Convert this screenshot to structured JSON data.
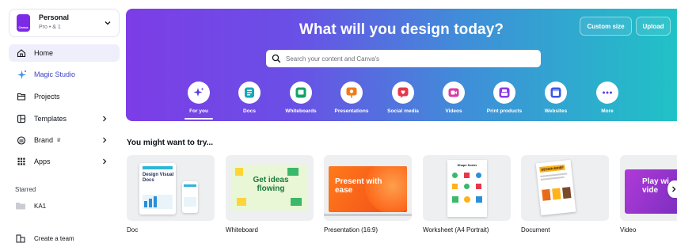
{
  "team": {
    "name": "Personal",
    "sub": "Pro • & 1",
    "logo_text": "Canva"
  },
  "nav": [
    {
      "label": "Home"
    },
    {
      "label": "Magic Studio"
    },
    {
      "label": "Projects"
    },
    {
      "label": "Templates"
    },
    {
      "label": "Brand"
    },
    {
      "label": "Apps"
    }
  ],
  "starred": {
    "title": "Starred",
    "items": [
      {
        "label": "KA1"
      }
    ]
  },
  "create_team_label": "Create a team",
  "hero": {
    "title": "What will you design today?",
    "custom_size_label": "Custom size",
    "upload_label": "Upload",
    "search_placeholder": "Search your content and Canva's",
    "categories": [
      {
        "label": "For you",
        "icon": "sparkle-icon",
        "color": "#5b3ce6"
      },
      {
        "label": "Docs",
        "icon": "doc-icon",
        "color": "#16a7b8"
      },
      {
        "label": "Whiteboards",
        "icon": "whiteboard-icon",
        "color": "#12a36a"
      },
      {
        "label": "Presentations",
        "icon": "presentation-icon",
        "color": "#f07b17"
      },
      {
        "label": "Social media",
        "icon": "heart-icon",
        "color": "#e6364a"
      },
      {
        "label": "Videos",
        "icon": "video-icon",
        "color": "#d63ea4"
      },
      {
        "label": "Print products",
        "icon": "print-icon",
        "color": "#8a3be6"
      },
      {
        "label": "Websites",
        "icon": "website-icon",
        "color": "#3b58e6"
      },
      {
        "label": "More",
        "icon": "more-icon",
        "color": "#5b3ce6"
      }
    ]
  },
  "suggestions": {
    "title": "You might want to try...",
    "cards": [
      {
        "label": "Doc",
        "thumb_text": "Design Visual Docs"
      },
      {
        "label": "Whiteboard",
        "thumb_text": "Get ideas flowing"
      },
      {
        "label": "Presentation (16:9)",
        "thumb_text": "Present with ease"
      },
      {
        "label": "Worksheet (A4 Portrait)",
        "thumb_text": "Shape Sorter"
      },
      {
        "label": "Document",
        "thumb_text": "DESIGN BRIEF"
      },
      {
        "label": "Video",
        "thumb_text": "Play wi vide"
      }
    ]
  }
}
